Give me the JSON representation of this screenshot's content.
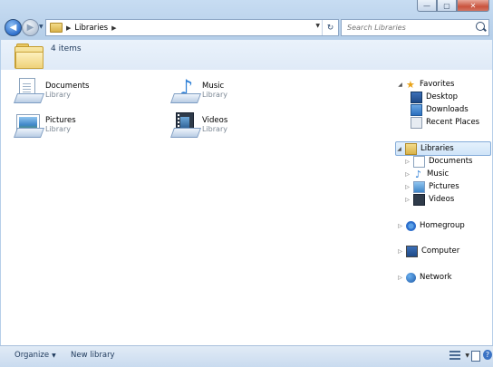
{
  "window": {
    "caption": {
      "min": "—",
      "max": "▢",
      "close": "✕"
    }
  },
  "nav": {
    "back_glyph": "◀",
    "forward_glyph": "▶",
    "breadcrumb": [
      "Libraries"
    ],
    "breadcrumb_sep": "▶",
    "refresh_glyph": "↻",
    "search_placeholder": "Search Libraries"
  },
  "header": {
    "count": "4 items"
  },
  "items": [
    {
      "name": "Documents",
      "type": "Library",
      "icon": "documents-library-icon"
    },
    {
      "name": "Music",
      "type": "Library",
      "icon": "music-library-icon"
    },
    {
      "name": "Pictures",
      "type": "Library",
      "icon": "pictures-library-icon"
    },
    {
      "name": "Videos",
      "type": "Library",
      "icon": "videos-library-icon"
    }
  ],
  "tree": {
    "favorites": {
      "label": "Favorites",
      "children": [
        "Desktop",
        "Downloads",
        "Recent Places"
      ]
    },
    "libraries": {
      "label": "Libraries",
      "children": [
        "Documents",
        "Music",
        "Pictures",
        "Videos"
      ]
    },
    "homegroup": "Homegroup",
    "computer": "Computer",
    "network": "Network",
    "expanded_glyph": "◢",
    "collapsed_glyph": "▷"
  },
  "toolbar": {
    "organize": "Organize",
    "new_library": "New library",
    "help_glyph": "?"
  }
}
